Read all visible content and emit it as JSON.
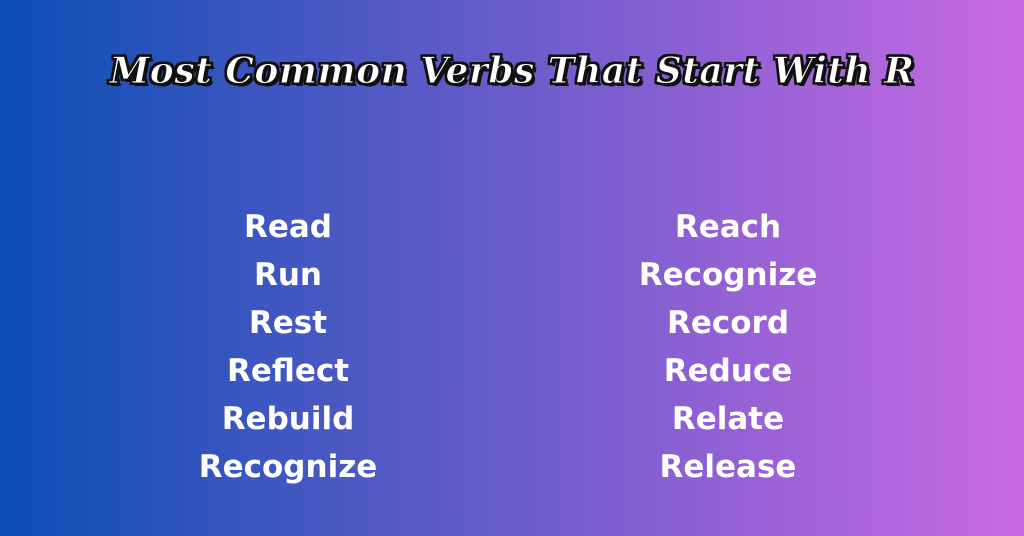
{
  "title": "Most Common Verbs That Start With R",
  "colors": {
    "gradient_start": "#0a4fb5",
    "gradient_end": "#c96ae3",
    "text": "#ffffff",
    "title_outline": "#111111"
  },
  "columns": [
    {
      "words": [
        "Read",
        "Run",
        "Rest",
        "Reflect",
        "Rebuild",
        "Recognize"
      ]
    },
    {
      "words": [
        "Reach",
        "Recognize",
        "Record",
        "Reduce",
        "Relate",
        "Release"
      ]
    }
  ]
}
